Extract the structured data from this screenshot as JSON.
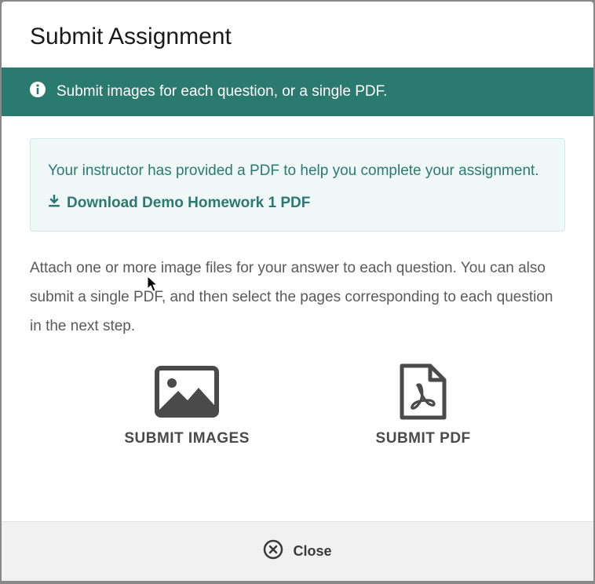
{
  "modal": {
    "title": "Submit Assignment",
    "info_banner": "Submit images for each question, or a single PDF.",
    "help_box": {
      "text": "Your instructor has provided a PDF to help you complete your assignment.",
      "download_label": "Download Demo Homework 1 PDF"
    },
    "instructions": "Attach one or more image files for your answer to each question. You can also submit a single PDF, and then select the pages corresponding to each question in the next step.",
    "options": {
      "images_label": "SUBMIT IMAGES",
      "pdf_label": "SUBMIT PDF"
    },
    "close_label": "Close"
  }
}
